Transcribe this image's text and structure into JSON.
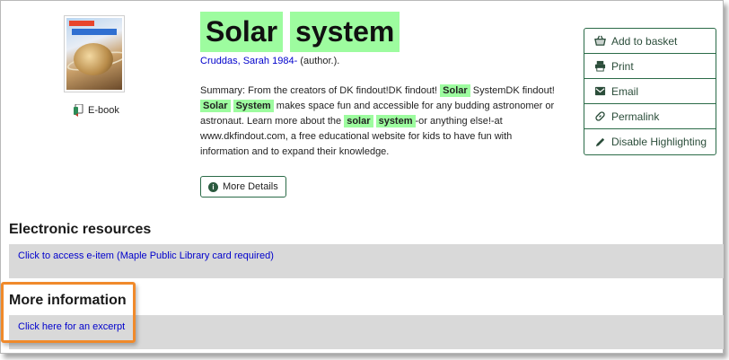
{
  "book": {
    "format_label": "E-book",
    "title_words": [
      "Solar",
      "system"
    ],
    "author_link": "Cruddas, Sarah 1984-",
    "author_role": " (author.).",
    "summary": [
      {
        "t": "Summary: From the creators of DK findout!DK findout! "
      },
      {
        "t": "Solar",
        "hl": true
      },
      {
        "t": " SystemDK findout! "
      },
      {
        "t": "Solar",
        "hl": true
      },
      {
        "t": " "
      },
      {
        "t": "System",
        "hl": true
      },
      {
        "t": " makes space fun and accessible for any budding astronomer or astronaut. Learn more about the "
      },
      {
        "t": "solar",
        "hl": true
      },
      {
        "t": " "
      },
      {
        "t": "system",
        "hl": true
      },
      {
        "t": "-or anything else!-at www.dkfindout.com, a free educational website for kids to have fun with information and to expand their knowledge."
      }
    ],
    "more_details_label": "More Details"
  },
  "toolbar": {
    "items": [
      {
        "label": "Add to basket",
        "icon": "basket-icon"
      },
      {
        "label": "Print",
        "icon": "print-icon"
      },
      {
        "label": "Email",
        "icon": "email-icon"
      },
      {
        "label": "Permalink",
        "icon": "link-icon"
      },
      {
        "label": "Disable Highlighting",
        "icon": "pencil-icon"
      }
    ]
  },
  "sections": {
    "electronic": {
      "title": "Electronic resources",
      "link": "Click to access e-item (Maple Public Library card required)"
    },
    "more_info": {
      "title": "More information",
      "link": "Click here for an excerpt"
    }
  },
  "colors": {
    "highlight": "#9dfc9f",
    "accent_border": "#2b6b48",
    "callout": "#f08a2b",
    "link": "#0000cc"
  }
}
